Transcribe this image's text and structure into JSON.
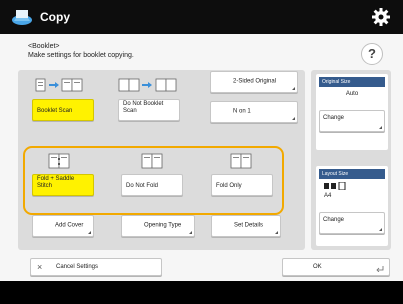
{
  "header": {
    "title": "Copy",
    "icon": "copy-icon",
    "settings_icon": "gear-icon"
  },
  "description": {
    "line1": "<Booklet>",
    "line2": "Make settings for booklet copying."
  },
  "help": {
    "label": "?"
  },
  "scan_buttons": [
    {
      "label": "Booklet Scan",
      "selected": true
    },
    {
      "label": "Do Not Booklet Scan",
      "selected": false
    }
  ],
  "options_right": {
    "two_sided_original": "2-Sided Original",
    "n_on_1": "N on 1"
  },
  "fold_buttons": [
    {
      "label": "Fold + Saddle Stitch",
      "selected": true
    },
    {
      "label": "Do Not Fold",
      "selected": false
    },
    {
      "label": "Fold Only",
      "selected": false
    }
  ],
  "bottom_options": {
    "add_cover": "Add Cover",
    "opening_type": "Opening Type",
    "set_details": "Set Details"
  },
  "original_size": {
    "header": "Original Size",
    "value": "Auto",
    "change": "Change"
  },
  "layout_size": {
    "header": "Layout Size",
    "value": "A4",
    "change": "Change"
  },
  "footer": {
    "cancel": "Cancel Settings",
    "ok": "OK"
  },
  "colors": {
    "accent_yellow": "#fff200",
    "frame_orange": "#f2a900",
    "side_header": "#355b8d"
  }
}
